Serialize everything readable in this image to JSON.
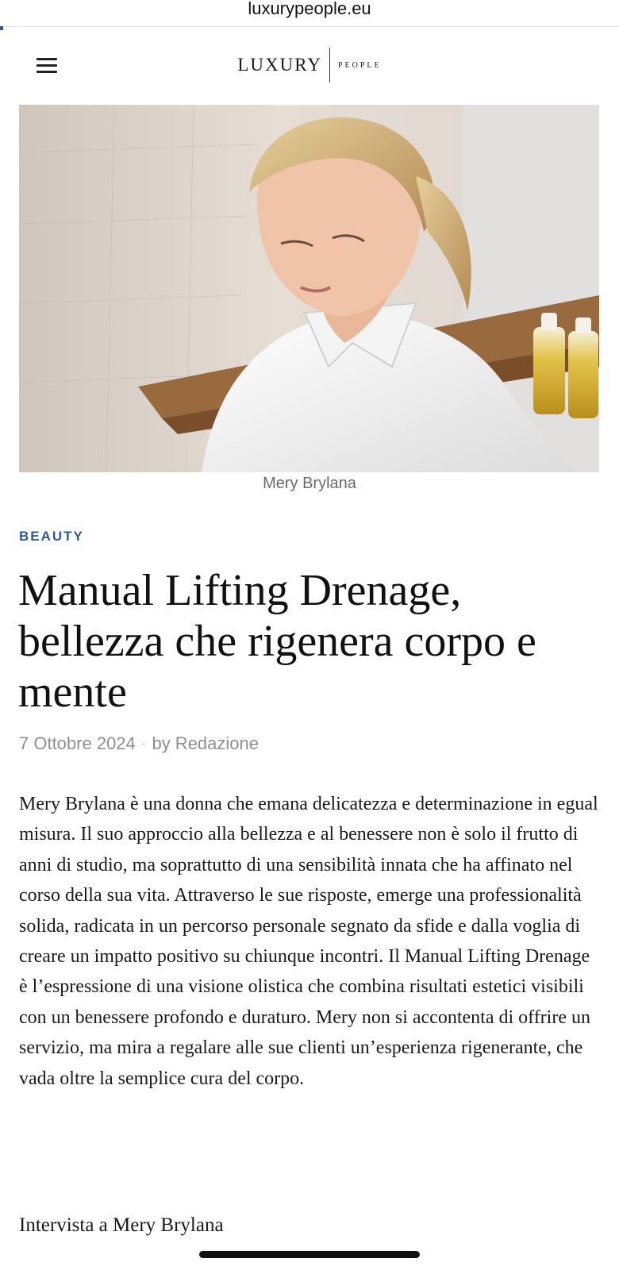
{
  "browser": {
    "url": "luxurypeople.eu"
  },
  "header": {
    "logo_main": "LUXURY",
    "logo_sub": "PEOPLE"
  },
  "hero": {
    "caption": "Mery Brylana"
  },
  "article": {
    "category": "BEAUTY",
    "title": "Manual Lifting Drenage, bellezza che rigenera corpo e mente",
    "date": "7 Ottobre 2024",
    "meta_separator": "·",
    "author": "by Redazione",
    "body": "Mery Brylana è una donna che emana delicatezza e determinazione in egual misura. Il suo approccio alla bellezza e al benessere non è solo il frutto di anni di studio, ma soprattutto di una sensibilità innata che ha affinato nel corso della sua vita. Attraverso le sue risposte, emerge una professionalità solida, radicata in un percorso personale segnato da sfide e dalla voglia di creare un impatto positivo su chiunque incontri. Il Manual Lifting Drenage è l’espressione di una visione olistica che combina risultati estetici visibili con un benessere profondo e duraturo. Mery non si accontenta di offrire un servizio, ma mira a regalare alle sue clienti un’esperienza rigenerante, che vada oltre la semplice cura del corpo.",
    "subheading": "Intervista a Mery Brylana"
  },
  "colors": {
    "accent": "#2e5a8e",
    "meta": "#8e8e8e",
    "caption": "#6a6a6a"
  }
}
